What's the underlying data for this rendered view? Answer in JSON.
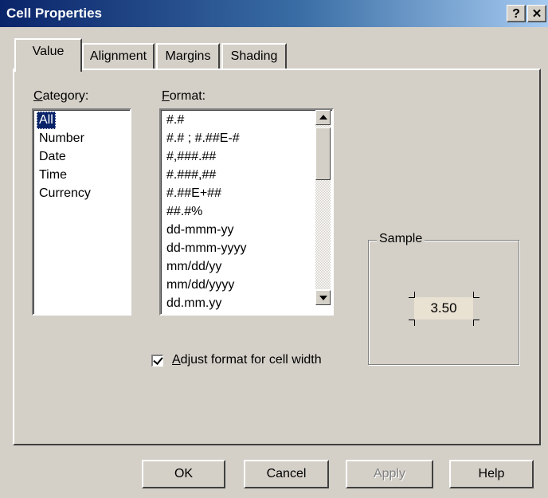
{
  "window": {
    "title": "Cell Properties",
    "help_button": "?",
    "close_button": "✕"
  },
  "tabs": [
    {
      "label": "Value",
      "active": true
    },
    {
      "label": "Alignment",
      "active": false
    },
    {
      "label": "Margins",
      "active": false
    },
    {
      "label": "Shading",
      "active": false
    }
  ],
  "category": {
    "label_hotkey": "C",
    "label_rest": "ategory:",
    "items": [
      "All",
      "Number",
      "Date",
      "Time",
      "Currency"
    ],
    "selected": "All"
  },
  "format": {
    "label_hotkey": "F",
    "label_rest": "ormat:",
    "items": [
      "#.#",
      "#.# ; #.##E-#",
      "#,###.##",
      "#.###,##",
      "#.##E+##",
      "##.#%",
      "dd-mmm-yy",
      "dd-mmm-yyyy",
      "mm/dd/yy",
      "mm/dd/yyyy",
      "dd.mm.yy"
    ]
  },
  "sample": {
    "legend": "Sample",
    "value": "3.50"
  },
  "adjust_checkbox": {
    "label_hotkey": "A",
    "label_rest": "djust format for cell width",
    "checked": true
  },
  "buttons": {
    "ok": "OK",
    "cancel": "Cancel",
    "apply": "Apply",
    "help": "Help"
  },
  "colors": {
    "titlebar_start": "#0a246a",
    "titlebar_end": "#a6caf0",
    "face": "#d4d0c8",
    "selection": "#0a246a",
    "sample_background": "#e9e1d1"
  }
}
